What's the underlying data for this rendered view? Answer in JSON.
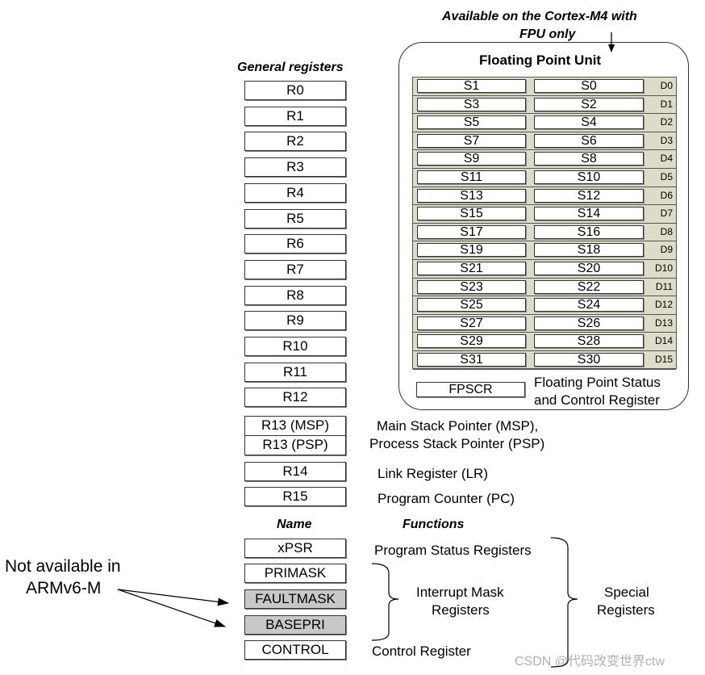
{
  "annotation_top": {
    "line1": "Available on the Cortex-M4 with",
    "line2": "FPU only"
  },
  "general_registers": {
    "title": "General registers",
    "items": [
      "R0",
      "R1",
      "R2",
      "R3",
      "R4",
      "R5",
      "R6",
      "R7",
      "R8",
      "R9",
      "R10",
      "R11",
      "R12"
    ],
    "r13_msp": "R13 (MSP)",
    "r13_psp": "R13 (PSP)",
    "r14": "R14",
    "r15": "R15",
    "r13_desc_line1": "Main Stack Pointer (MSP),",
    "r13_desc_line2": "Process Stack Pointer (PSP)",
    "r14_desc": "Link Register (LR)",
    "r15_desc": "Program Counter (PC)"
  },
  "fpu": {
    "title": "Floating Point Unit",
    "rows": [
      {
        "hi": "S1",
        "lo": "S0",
        "d": "D0"
      },
      {
        "hi": "S3",
        "lo": "S2",
        "d": "D1"
      },
      {
        "hi": "S5",
        "lo": "S4",
        "d": "D2"
      },
      {
        "hi": "S7",
        "lo": "S6",
        "d": "D3"
      },
      {
        "hi": "S9",
        "lo": "S8",
        "d": "D4"
      },
      {
        "hi": "S11",
        "lo": "S10",
        "d": "D5"
      },
      {
        "hi": "S13",
        "lo": "S12",
        "d": "D6"
      },
      {
        "hi": "S15",
        "lo": "S14",
        "d": "D7"
      },
      {
        "hi": "S17",
        "lo": "S16",
        "d": "D8"
      },
      {
        "hi": "S19",
        "lo": "S18",
        "d": "D9"
      },
      {
        "hi": "S21",
        "lo": "S20",
        "d": "D10"
      },
      {
        "hi": "S23",
        "lo": "S22",
        "d": "D11"
      },
      {
        "hi": "S25",
        "lo": "S24",
        "d": "D12"
      },
      {
        "hi": "S27",
        "lo": "S26",
        "d": "D13"
      },
      {
        "hi": "S29",
        "lo": "S28",
        "d": "D14"
      },
      {
        "hi": "S31",
        "lo": "S30",
        "d": "D15"
      }
    ],
    "fpscr": "FPSCR",
    "fpscr_desc_line1": "Floating Point Status",
    "fpscr_desc_line2": "and Control Register"
  },
  "special": {
    "name_header": "Name",
    "functions_header": "Functions",
    "xpsr": "xPSR",
    "primask": "PRIMASK",
    "faultmask": "FAULTMASK",
    "basepri": "BASEPRI",
    "control": "CONTROL",
    "xpsr_desc": "Program Status Registers",
    "mask_desc_line1": "Interrupt Mask",
    "mask_desc_line2": "Registers",
    "control_desc": "Control Register",
    "group_line1": "Special",
    "group_line2": "Registers"
  },
  "not_available": {
    "line1": "Not available in",
    "line2": "ARMv6-M"
  },
  "watermark": "CSDN @代码改变世界ctw",
  "colors": {
    "grey_register": "#c8c8c8",
    "fpu_background": "#dcdcc8"
  }
}
